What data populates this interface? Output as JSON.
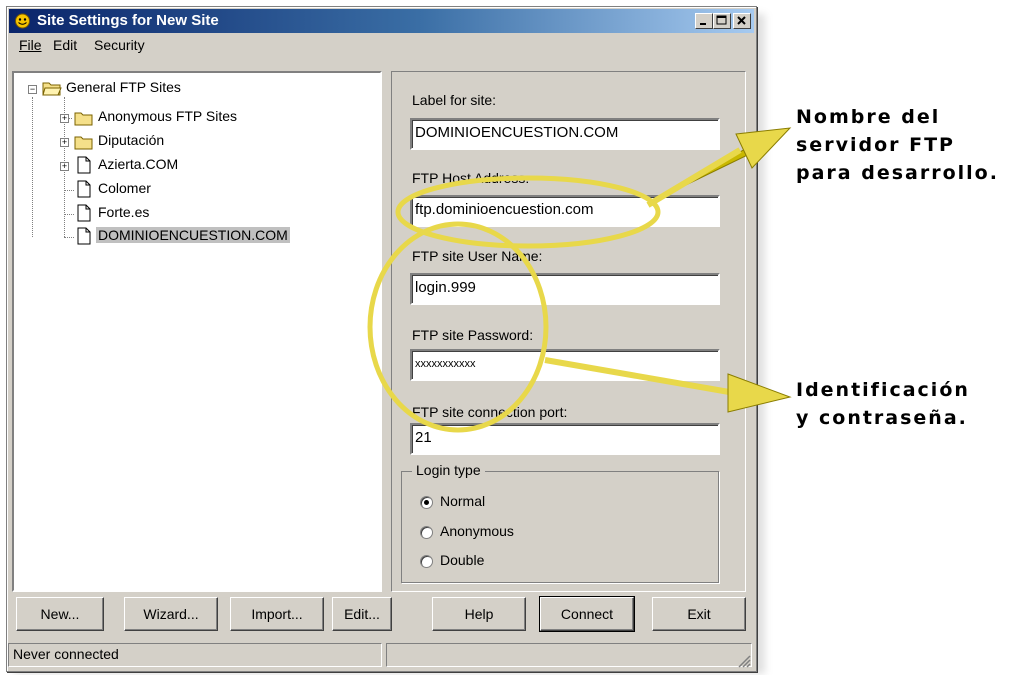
{
  "window": {
    "title": "Site Settings for New Site",
    "controls": [
      "_",
      "□",
      "X"
    ]
  },
  "menu": {
    "file": "File",
    "edit": "Edit",
    "security": "Security"
  },
  "tree": {
    "root": "General FTP Sites",
    "items": [
      {
        "label": "Anonymous FTP Sites",
        "icon": "folder-icon",
        "expandable": true
      },
      {
        "label": "Diputación",
        "icon": "folder-icon",
        "expandable": true
      },
      {
        "label": "Azierta.COM",
        "icon": "page-icon",
        "expandable": true
      },
      {
        "label": "Colomer",
        "icon": "page-icon",
        "expandable": false
      },
      {
        "label": "Forte.es",
        "icon": "page-icon",
        "expandable": false
      },
      {
        "label": "DOMINIOENCUESTION.COM",
        "icon": "page-icon",
        "expandable": false,
        "selected": true
      }
    ]
  },
  "form": {
    "label_for_site": "Label for site:",
    "label_value": "DOMINIOENCUESTION.COM",
    "host_label": "FTP Host Address:",
    "host_value": "ftp.dominioencuestion.com",
    "user_label": "FTP site User Name:",
    "user_value": "login.999",
    "password_label": "FTP site Password:",
    "password_value": "xxxxxxxxxxx",
    "port_label": "FTP site connection port:",
    "port_value": "21",
    "login_type": {
      "title": "Login type",
      "options": [
        "Normal",
        "Anonymous",
        "Double"
      ],
      "selected": "Normal"
    }
  },
  "buttons": {
    "new": "New...",
    "wizard": "Wizard...",
    "import": "Import...",
    "edit": "Edit...",
    "help": "Help",
    "connect": "Connect",
    "exit": "Exit"
  },
  "status": {
    "text": "Never connected",
    "right": ""
  },
  "annotations": {
    "server_line1": "Nombre del",
    "server_line2": "servidor FTP",
    "server_line3": "para desarrollo.",
    "cred_line1": "Identificación",
    "cred_line2": "y contraseña."
  },
  "colors": {
    "title_start": "#0a246a",
    "title_end": "#a6caf0",
    "window_bg": "#d4d0c8",
    "highlight": "#e8d84a"
  }
}
